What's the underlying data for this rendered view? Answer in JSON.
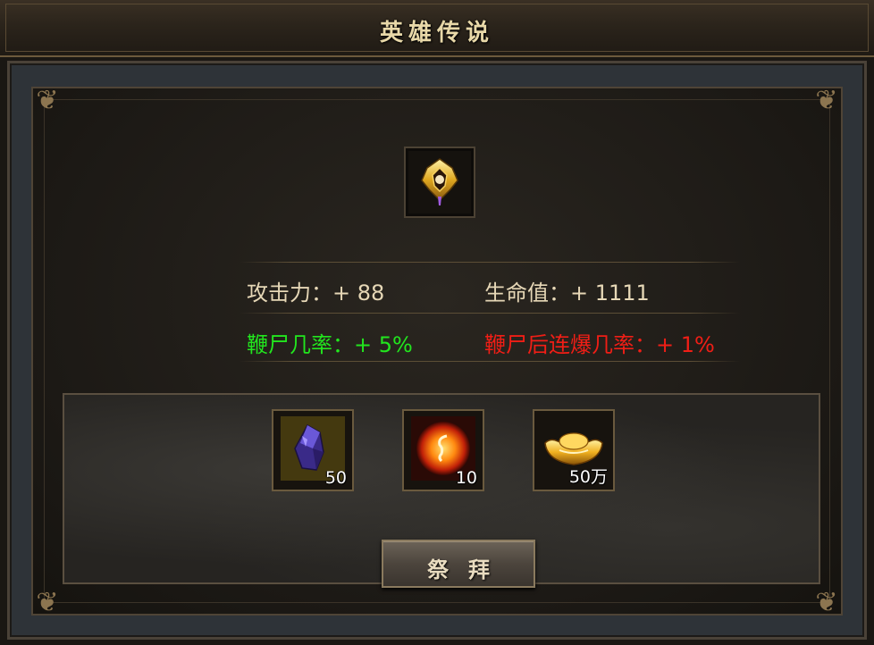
{
  "window": {
    "title": "英雄传说"
  },
  "hero_item": {
    "icon": "golden-emblem-icon"
  },
  "stats": {
    "attack": "攻击力：+ 88",
    "hp": "生命值：+ 1111",
    "whip_rate": "鞭尸几率：+ 5%",
    "whip_burst_rate": "鞭尸后连爆几率：+ 1%"
  },
  "costs": [
    {
      "icon": "purple-crystal-icon",
      "quantity": "50"
    },
    {
      "icon": "fire-orb-icon",
      "quantity": "10"
    },
    {
      "icon": "gold-ingot-icon",
      "quantity": "50万"
    }
  ],
  "worship_button": {
    "label": "祭拜"
  },
  "colors": {
    "title": "#e8d8a8",
    "stat_normal": "#e6d7b6",
    "stat_green": "#22e61e",
    "stat_red": "#f01e16"
  }
}
